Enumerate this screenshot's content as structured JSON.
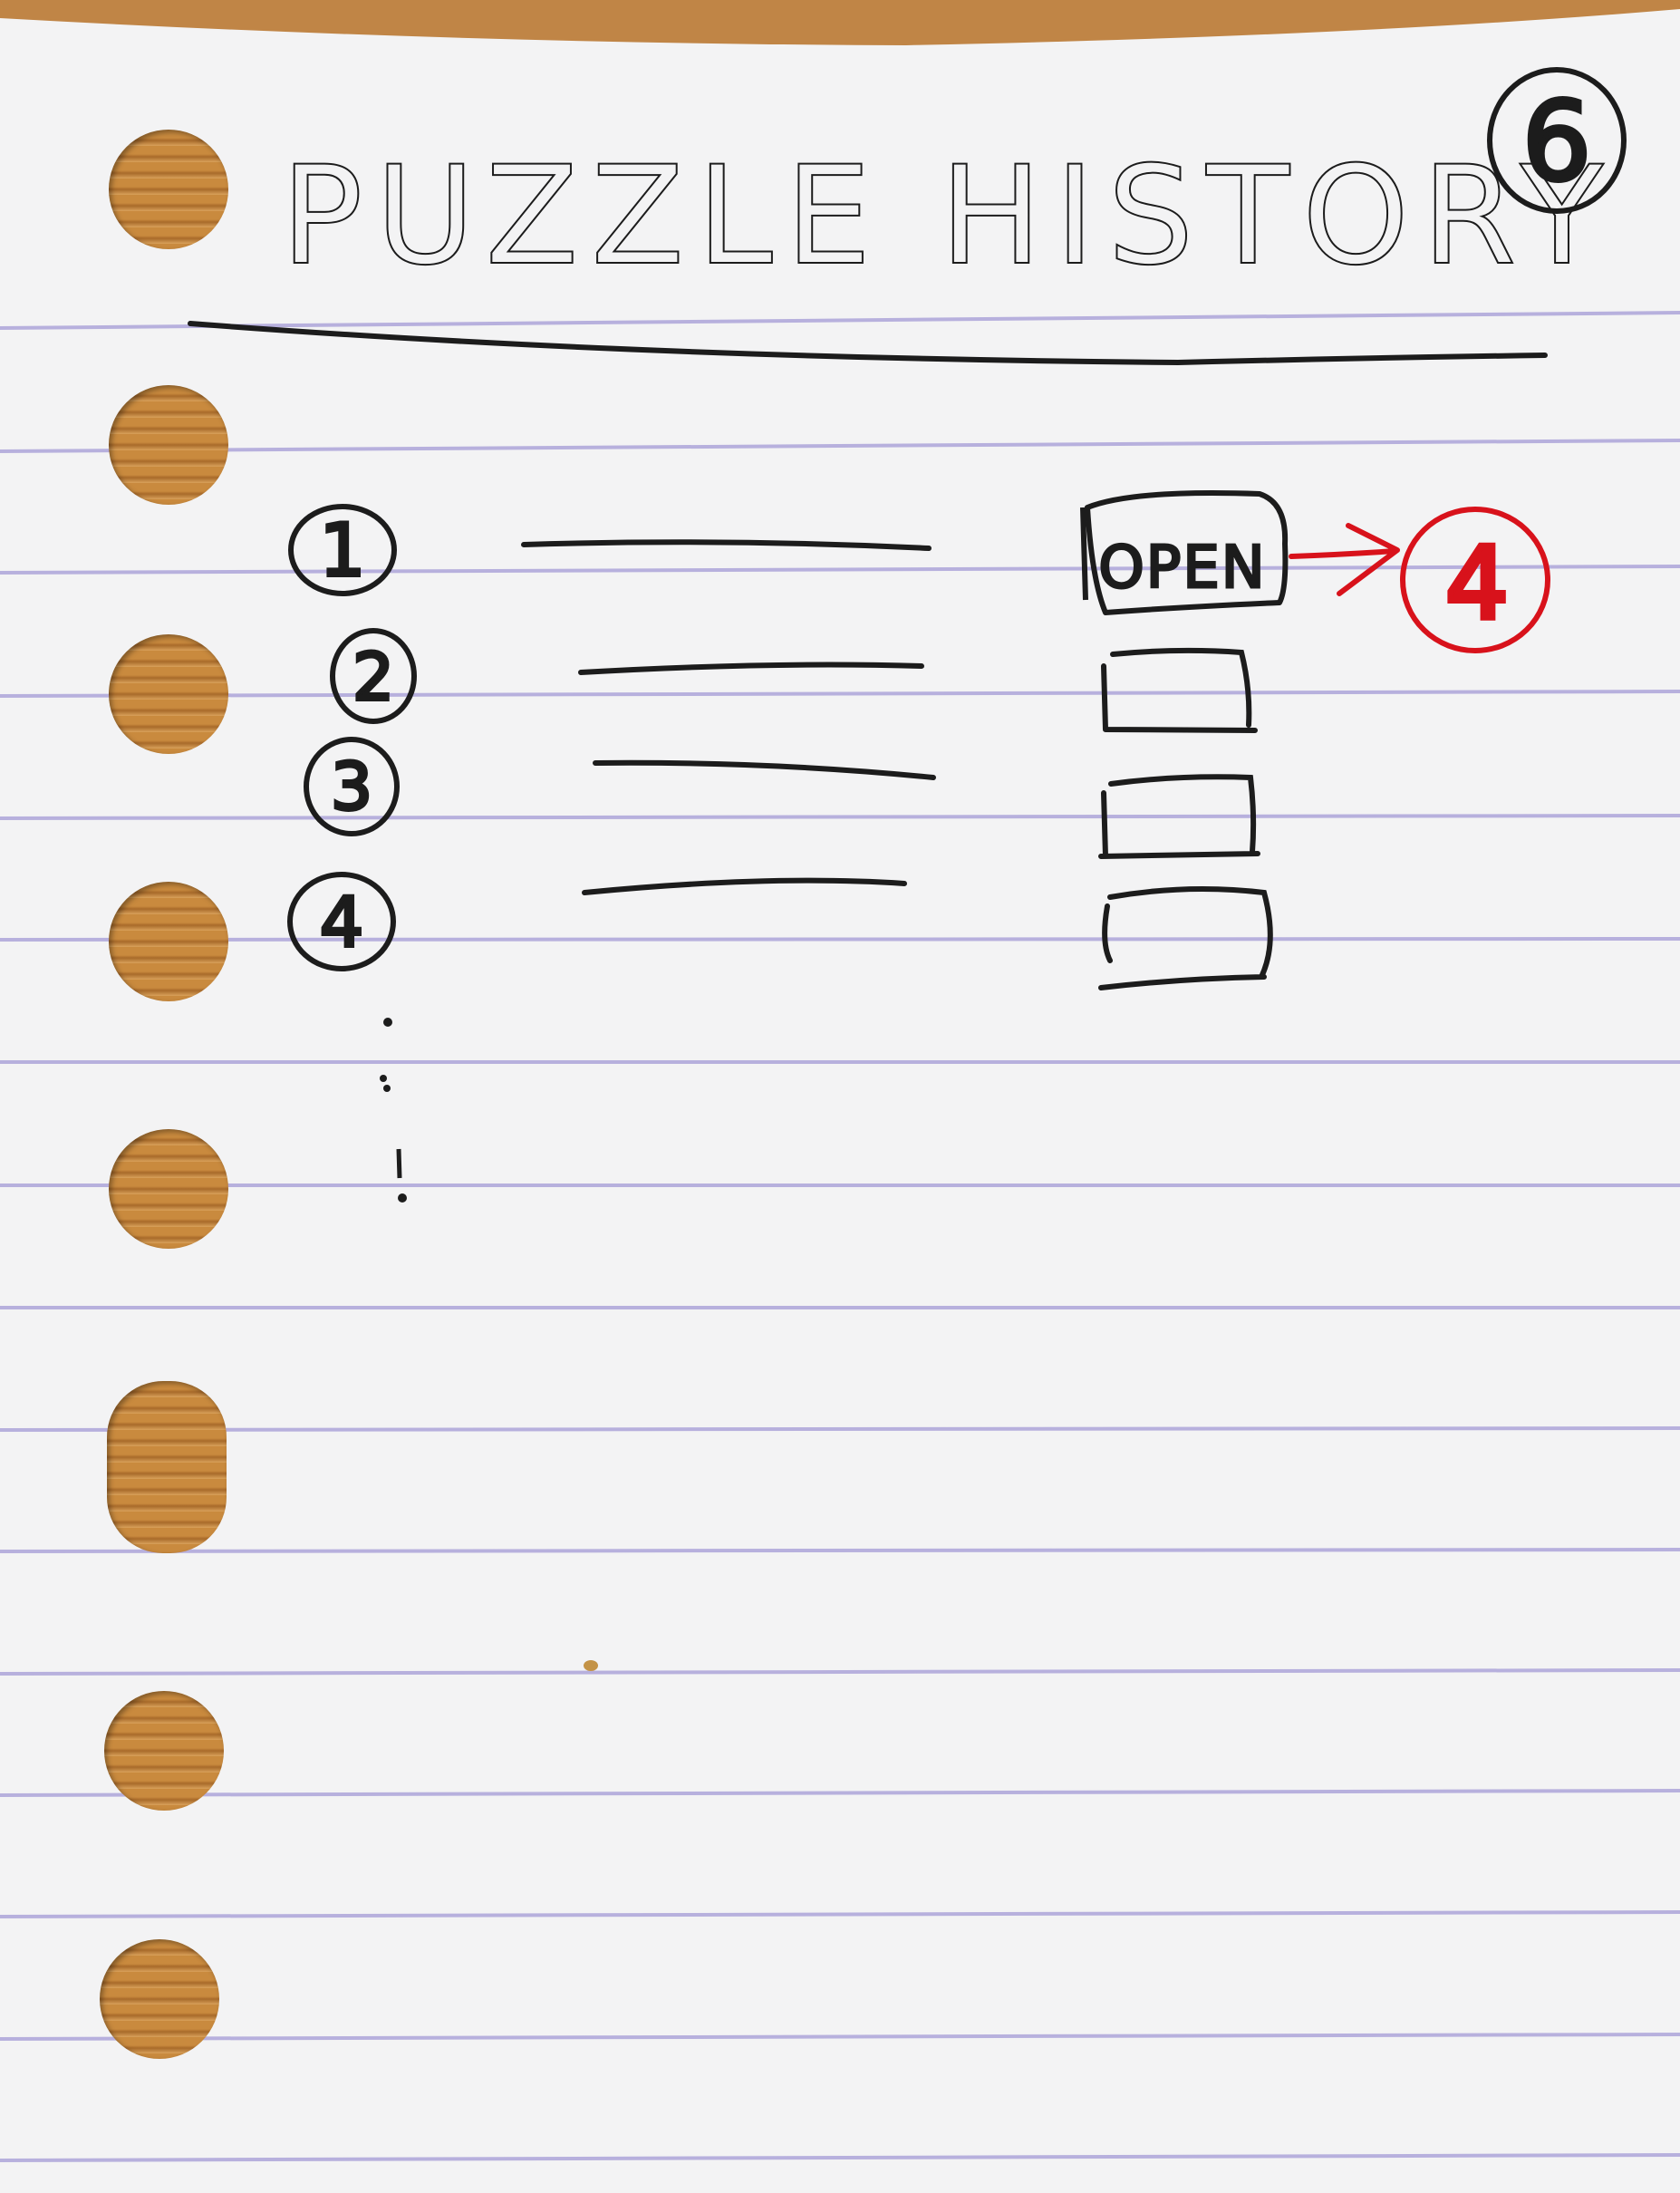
{
  "page": {
    "title": "PUZZLE HISTORY",
    "page_number": "6"
  },
  "list": {
    "items": [
      {
        "number": "1",
        "action": "OPEN"
      },
      {
        "number": "2",
        "action": ""
      },
      {
        "number": "3",
        "action": ""
      },
      {
        "number": "4",
        "action": ""
      }
    ]
  },
  "callout": {
    "target": "4"
  },
  "colors": {
    "ink": "#1c1c1c",
    "red_ink": "#d8121b",
    "paper": "#f3f3f4",
    "rule_line": "#b7b0dd"
  }
}
